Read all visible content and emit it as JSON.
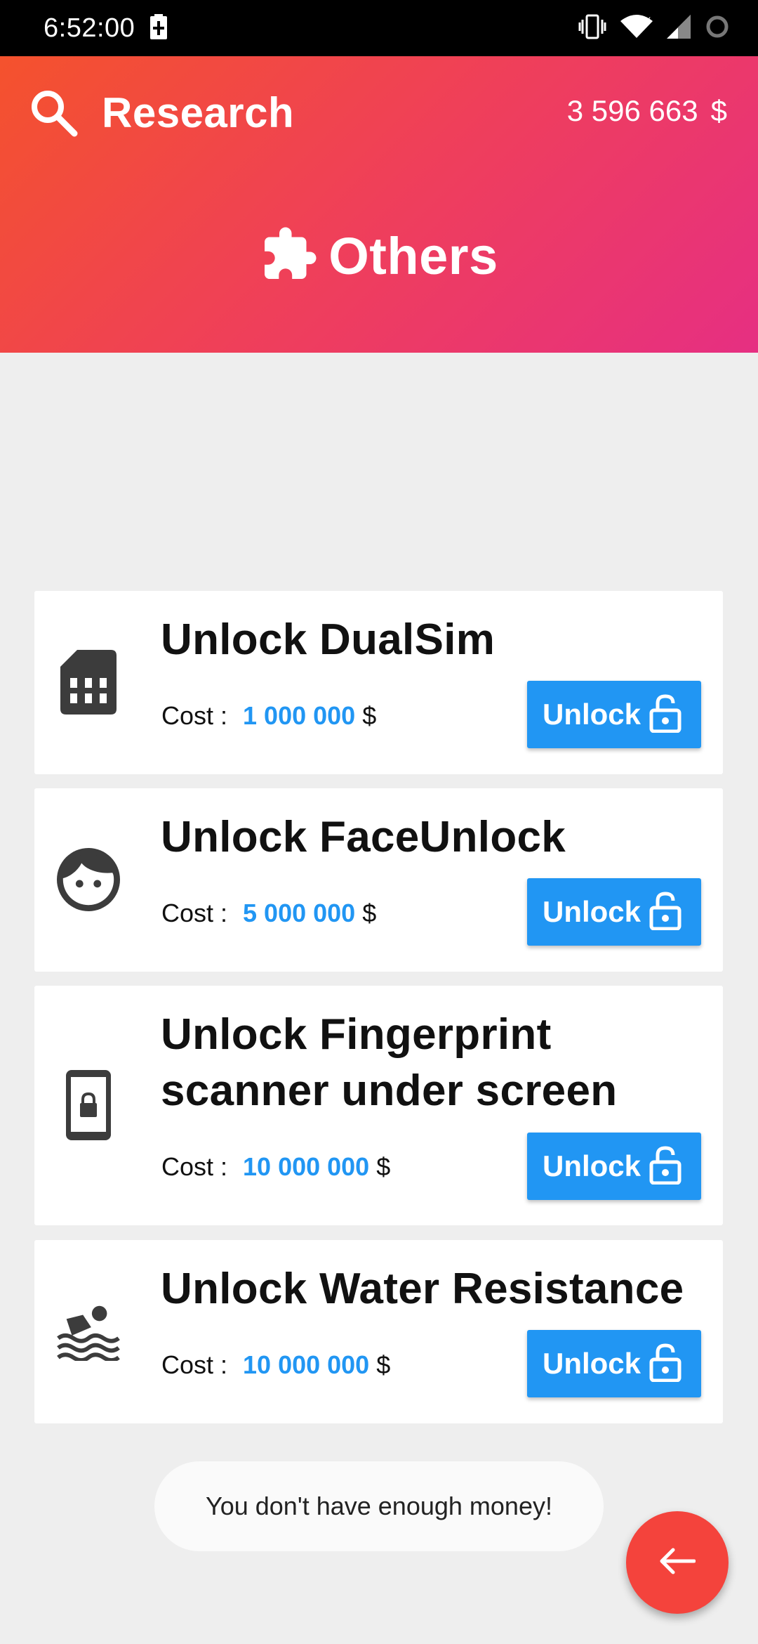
{
  "status_bar": {
    "time": "6:52:00",
    "battery_icon": "battery-charging-icon",
    "vibrate_icon": "vibrate-icon",
    "wifi_icon": "wifi-icon",
    "signal_icon": "signal-icon",
    "sync_icon": "ring-icon"
  },
  "header": {
    "title": "Research",
    "money_amount": "3 596 663",
    "money_currency": "$",
    "category": "Others",
    "search_icon": "search-icon",
    "category_icon": "puzzle-icon",
    "gradient_start": "#f4522d",
    "gradient_end": "#e62f82"
  },
  "upgrades": [
    {
      "title": "Unlock DualSim",
      "cost_label": "Cost :",
      "cost_value": "1 000 000",
      "currency": "$",
      "button_label": "Unlock",
      "icon": "sim-card-icon"
    },
    {
      "title": "Unlock FaceUnlock",
      "cost_label": "Cost :",
      "cost_value": "5 000 000",
      "currency": "$",
      "button_label": "Unlock",
      "icon": "face-icon"
    },
    {
      "title_line1": "Unlock Fingerprint",
      "title_line2": "scanner under screen",
      "cost_label": "Cost :",
      "cost_value": "10 000 000",
      "currency": "$",
      "button_label": "Unlock",
      "icon": "phone-lock-icon"
    },
    {
      "title": "Unlock Water Resistance",
      "cost_label": "Cost :",
      "cost_value": "10 000 000",
      "currency": "$",
      "button_label": "Unlock",
      "icon": "swimming-icon"
    }
  ],
  "toast": {
    "message": "You don't have enough money!"
  },
  "fab": {
    "icon": "arrow-left-icon"
  },
  "colors": {
    "accent_blue": "#2196f3",
    "fab_red": "#f4433c",
    "background": "#eeeeee"
  }
}
